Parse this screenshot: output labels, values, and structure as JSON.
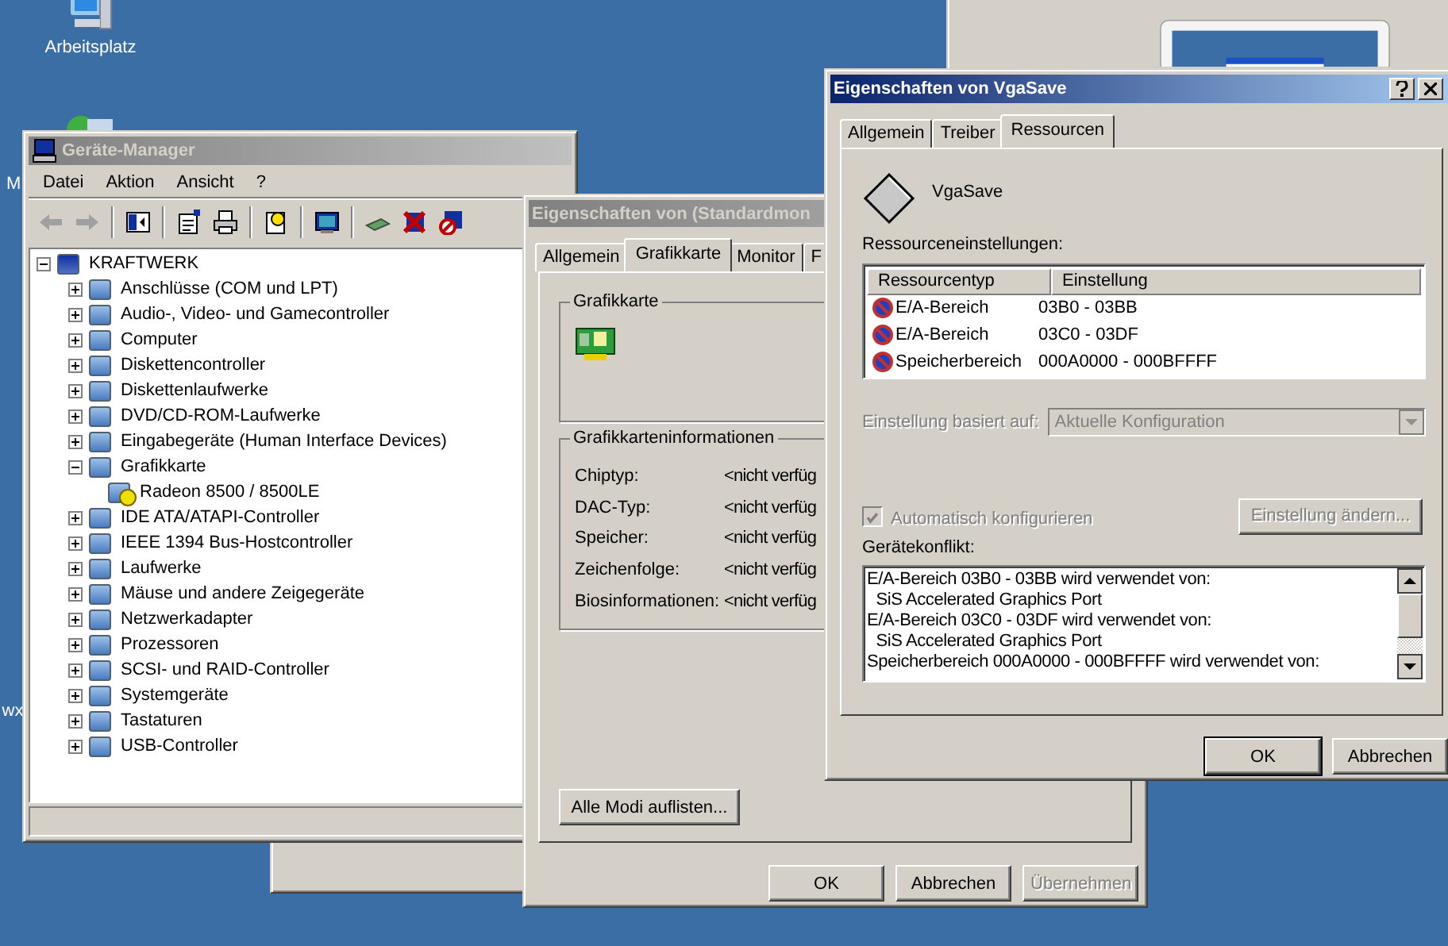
{
  "desktop": {
    "icons": [
      {
        "label": "Arbeitsplatz",
        "kind": "computer"
      },
      {
        "label": "M",
        "kind": "network"
      },
      {
        "label": "wx",
        "kind": "hidden"
      }
    ]
  },
  "device_manager": {
    "title": "Geräte-Manager",
    "menu": [
      "Datei",
      "Aktion",
      "Ansicht",
      "?"
    ],
    "tree": {
      "label": "KRAFTWERK",
      "expanded": true,
      "children": [
        {
          "label": "Anschlüsse (COM und LPT)",
          "expanded": false
        },
        {
          "label": "Audio-, Video- und Gamecontroller",
          "expanded": false
        },
        {
          "label": "Computer",
          "expanded": false
        },
        {
          "label": "Diskettencontroller",
          "expanded": false
        },
        {
          "label": "Diskettenlaufwerke",
          "expanded": false
        },
        {
          "label": "DVD/CD-ROM-Laufwerke",
          "expanded": false
        },
        {
          "label": "Eingabegeräte (Human Interface Devices)",
          "expanded": false
        },
        {
          "label": "Grafikkarte",
          "expanded": true,
          "children": [
            {
              "label": "Radeon 8500 / 8500LE",
              "warning": true
            }
          ]
        },
        {
          "label": "IDE ATA/ATAPI-Controller",
          "expanded": false
        },
        {
          "label": "IEEE 1394 Bus-Hostcontroller",
          "expanded": false
        },
        {
          "label": "Laufwerke",
          "expanded": false
        },
        {
          "label": "Mäuse und andere Zeigegeräte",
          "expanded": false
        },
        {
          "label": "Netzwerkadapter",
          "expanded": false
        },
        {
          "label": "Prozessoren",
          "expanded": false
        },
        {
          "label": "SCSI- und RAID-Controller",
          "expanded": false
        },
        {
          "label": "Systemgeräte",
          "expanded": false
        },
        {
          "label": "Tastaturen",
          "expanded": false
        },
        {
          "label": "USB-Controller",
          "expanded": false
        }
      ]
    }
  },
  "display_dialog": {
    "title": "Eigenschaften von (Standardmon",
    "tabs": [
      {
        "label": "Allgemein",
        "selected": false
      },
      {
        "label": "Grafikkarte",
        "selected": true
      },
      {
        "label": "Monitor",
        "selected": false
      },
      {
        "label": "F",
        "selected": false
      }
    ],
    "card_group": "Grafikkarte",
    "info_group": "Grafikkarteninformationen",
    "info": [
      {
        "label": "Chiptyp:",
        "value": "<nicht verfüg"
      },
      {
        "label": "DAC-Typ:",
        "value": "<nicht verfüg"
      },
      {
        "label": "Speicher:",
        "value": "<nicht verfüg"
      },
      {
        "label": "Zeichenfolge:",
        "value": "<nicht verfüg"
      },
      {
        "label": "Biosinformationen:",
        "value": "<nicht verfüg"
      }
    ],
    "list_modes_button": "Alle Modi auflisten...",
    "buttons": [
      {
        "label": "OK",
        "disabled": false
      },
      {
        "label": "Abbrechen",
        "disabled": false
      },
      {
        "label": "Übernehmen",
        "disabled": true
      }
    ]
  },
  "vga_dialog": {
    "title": "Eigenschaften von VgaSave",
    "tabs": [
      {
        "label": "Allgemein",
        "selected": false
      },
      {
        "label": "Treiber",
        "selected": false
      },
      {
        "label": "Ressourcen",
        "selected": true
      }
    ],
    "device_name": "VgaSave",
    "resources_label": "Ressourceneinstellungen:",
    "columns": [
      "Ressourcentyp",
      "Einstellung"
    ],
    "rows": [
      {
        "type": "E/A-Bereich",
        "setting": "03B0 - 03BB"
      },
      {
        "type": "E/A-Bereich",
        "setting": "03C0 - 03DF"
      },
      {
        "type": "Speicherbereich",
        "setting": "000A0000 - 000BFFFF"
      }
    ],
    "based_on": {
      "label": "Einstellung basiert auf:",
      "value": "Aktuelle Konfiguration",
      "disabled": true
    },
    "auto_configure": {
      "label": "Automatisch konfigurieren",
      "checked": true,
      "disabled": true
    },
    "change_button": {
      "label": "Einstellung ändern...",
      "disabled": true
    },
    "conflict_label": "Gerätekonflikt:",
    "conflict_lines": [
      "E/A-Bereich 03B0 - 03BB wird verwendet von:",
      "  SiS Accelerated Graphics Port",
      "E/A-Bereich 03C0 - 03DF wird verwendet von:",
      "  SiS Accelerated Graphics Port",
      "Speicherbereich 000A0000 - 000BFFFF wird verwendet von:"
    ],
    "buttons": [
      {
        "label": "OK",
        "disabled": false
      },
      {
        "label": "Abbrechen",
        "disabled": false
      }
    ]
  }
}
